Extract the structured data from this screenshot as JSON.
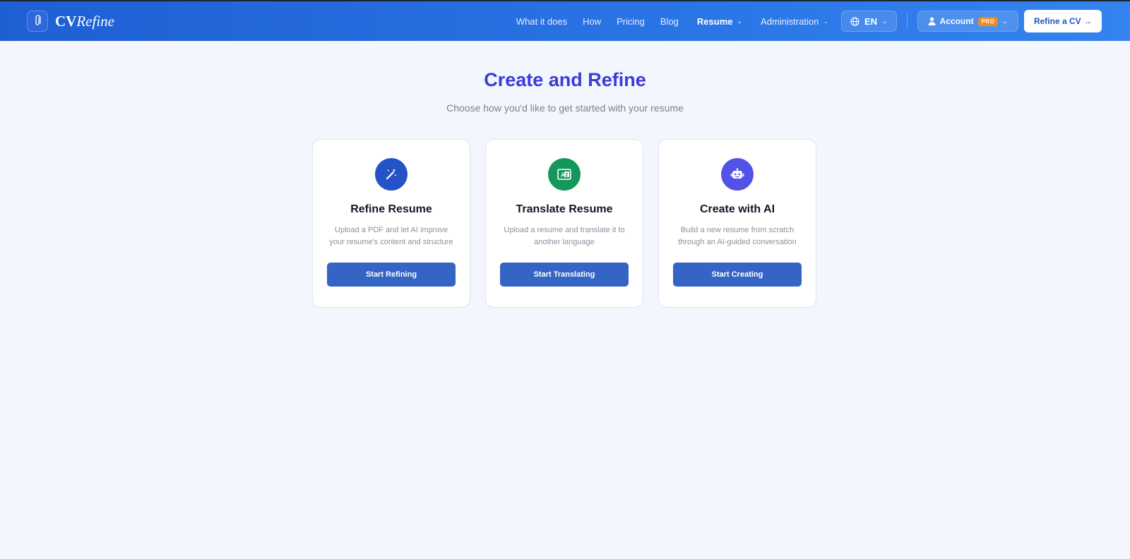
{
  "brand": {
    "name_bold": "CV",
    "name_italic": "Refine"
  },
  "nav": {
    "links": [
      "What it does",
      "How",
      "Pricing",
      "Blog"
    ],
    "resume": "Resume",
    "administration": "Administration",
    "language": "EN",
    "account": "Account",
    "pro": "PRO",
    "cta": "Refine a CV →"
  },
  "main": {
    "title": "Create and Refine",
    "subtitle": "Choose how you'd like to get started with your resume"
  },
  "cards": [
    {
      "title": "Refine Resume",
      "description": "Upload a PDF and let AI improve your resume's content and structure",
      "button": "Start Refining",
      "icon": "magic-wand-icon",
      "color": "#2453c8"
    },
    {
      "title": "Translate Resume",
      "description": "Upload a resume and translate it to another language",
      "button": "Start Translating",
      "icon": "translate-icon",
      "color": "#14975a"
    },
    {
      "title": "Create with AI",
      "description": "Build a new resume from scratch through an AI-guided conversation",
      "button": "Start Creating",
      "icon": "robot-icon",
      "color": "#5352e8"
    }
  ]
}
